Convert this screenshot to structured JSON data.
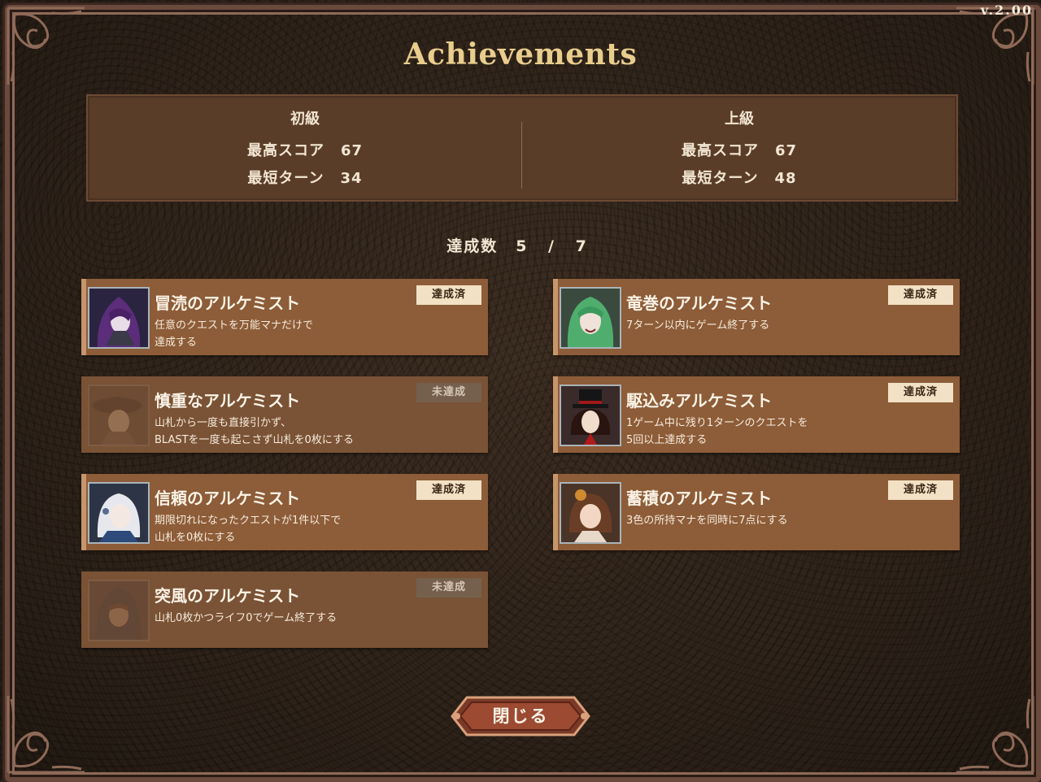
{
  "version": "v.2.00",
  "title": "Achievements",
  "scores": {
    "beginner": {
      "level": "初級",
      "best_score_label": "最高スコア",
      "best_score": "67",
      "shortest_turn_label": "最短ターン",
      "shortest_turn": "34"
    },
    "advanced": {
      "level": "上級",
      "best_score_label": "最高スコア",
      "best_score": "67",
      "shortest_turn_label": "最短ターン",
      "shortest_turn": "48"
    }
  },
  "progress": {
    "label": "達成数",
    "value": "5 / 7"
  },
  "achievements": [
    {
      "name": "冒涜のアルケミスト",
      "desc": [
        "任意のクエストを万能マナだけで",
        "達成する"
      ],
      "status": "達成済",
      "achieved": true,
      "portrait": "purple-hooded-alchemist"
    },
    {
      "name": "竜巻のアルケミスト",
      "desc": [
        "7ターン以内にゲーム終了する"
      ],
      "status": "達成済",
      "achieved": true,
      "portrait": "green-haired-alchemist"
    },
    {
      "name": "慎重なアルケミスト",
      "desc": [
        "山札から一度も直接引かず、",
        "BLASTを一度も起こさず山札を0枚にする"
      ],
      "status": "未達成",
      "achieved": false,
      "portrait": "hat-alchemist"
    },
    {
      "name": "駆込みアルケミスト",
      "desc": [
        "1ゲーム中に残り1ターンのクエストを",
        "5回以上達成する"
      ],
      "status": "達成済",
      "achieved": true,
      "portrait": "top-hat-alchemist"
    },
    {
      "name": "信頼のアルケミスト",
      "desc": [
        "期限切れになったクエストが1件以下で",
        "山札を0枚にする"
      ],
      "status": "達成済",
      "achieved": true,
      "portrait": "white-haired-alchemist"
    },
    {
      "name": "蓄積のアルケミスト",
      "desc": [
        "3色の所持マナを同時に7点にする"
      ],
      "status": "達成済",
      "achieved": true,
      "portrait": "brown-haired-alchemist"
    },
    {
      "name": "突風のアルケミスト",
      "desc": [
        "山札0枚かつライフ0でゲーム終了する"
      ],
      "status": "未達成",
      "achieved": false,
      "portrait": "cloaked-alchemist"
    }
  ],
  "close_button": "閉じる",
  "colors": {
    "title": "#e9cd8d",
    "card": "#8d5c38",
    "badge_achieved": "#f2e1c4",
    "badge_locked": "#75604e"
  }
}
